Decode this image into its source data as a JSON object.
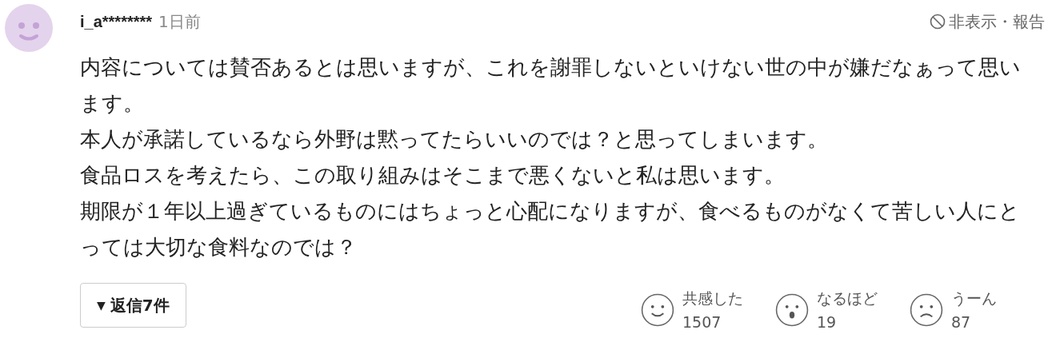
{
  "comment": {
    "user": "i_a********",
    "time": "1日前",
    "actions": "非表示・報告",
    "paragraphs": [
      "内容については賛否あるとは思いますが、これを謝罪しないといけない世の中が嫌だなぁって思います。",
      "本人が承諾しているなら外野は黙ってたらいいのでは？と思ってしまいます。",
      "食品ロスを考えたら、この取り組みはそこまで悪くないと私は思います。",
      "期限が１年以上過ぎているものにはちょっと心配になりますが、食べるものがなくて苦しい人にとっては大切な食料なのでは？"
    ],
    "replies_button": {
      "caret": "▼",
      "label": "返信7件"
    },
    "reactions": [
      {
        "kind": "smile",
        "label": "共感した",
        "count": "1507"
      },
      {
        "kind": "surprise",
        "label": "なるほど",
        "count": "19"
      },
      {
        "kind": "frown",
        "label": "うーん",
        "count": "87"
      }
    ]
  }
}
